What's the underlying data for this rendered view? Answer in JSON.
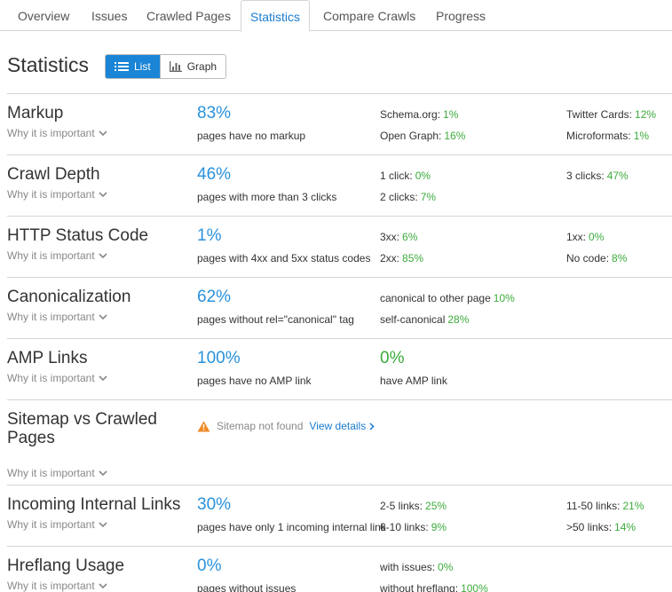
{
  "tabs": [
    {
      "label": "Overview",
      "active": false
    },
    {
      "label": "Issues",
      "active": false
    },
    {
      "label": "Crawled Pages",
      "active": false
    },
    {
      "label": "Statistics",
      "active": true
    },
    {
      "label": "Compare Crawls",
      "active": false
    },
    {
      "label": "Progress",
      "active": false
    }
  ],
  "page": {
    "title": "Statistics",
    "view_toggle": {
      "list_label": "List",
      "graph_label": "Graph",
      "selected": "List"
    }
  },
  "why_label": "Why it is important",
  "rows": {
    "markup": {
      "title": "Markup",
      "main_value": "83%",
      "main_desc": "pages have no markup",
      "stats": [
        {
          "label": "Schema.org:",
          "value": "1%"
        },
        {
          "label": "Open Graph:",
          "value": "16%"
        },
        {
          "label": "Twitter Cards:",
          "value": "12%"
        },
        {
          "label": "Microformats:",
          "value": "1%"
        }
      ]
    },
    "crawl_depth": {
      "title": "Crawl Depth",
      "main_value": "46%",
      "main_desc": "pages with more than 3 clicks",
      "stats": [
        {
          "label": "1 click:",
          "value": "0%"
        },
        {
          "label": "2 clicks:",
          "value": "7%"
        },
        {
          "label": "3 clicks:",
          "value": "47%"
        }
      ]
    },
    "http_status": {
      "title": "HTTP Status Code",
      "main_value": "1%",
      "main_desc": "pages with 4xx and 5xx status codes",
      "stats": [
        {
          "label": "3xx:",
          "value": "6%"
        },
        {
          "label": "2xx:",
          "value": "85%"
        },
        {
          "label": "1xx:",
          "value": "0%"
        },
        {
          "label": "No code:",
          "value": "8%"
        }
      ]
    },
    "canonicalization": {
      "title": "Canonicalization",
      "main_value": "62%",
      "main_desc": "pages without rel=\"canonical\" tag",
      "stats": [
        {
          "label": "canonical to other page",
          "value": "10%"
        },
        {
          "label": "self-canonical",
          "value": "28%"
        }
      ]
    },
    "amp_links": {
      "title": "AMP Links",
      "main_value": "100%",
      "main_desc": "pages have no AMP link",
      "secondary_value": "0%",
      "secondary_desc": "have AMP link"
    },
    "sitemap": {
      "title": "Sitemap vs Crawled Pages",
      "message": "Sitemap not found",
      "link": "View details"
    },
    "internal_links": {
      "title": "Incoming Internal Links",
      "main_value": "30%",
      "main_desc": "pages have only 1 incoming internal link",
      "stats": [
        {
          "label": "2-5 links:",
          "value": "25%"
        },
        {
          "label": "6-10 links:",
          "value": "9%"
        },
        {
          "label": "11-50 links:",
          "value": "21%"
        },
        {
          "label": ">50 links:",
          "value": "14%"
        }
      ]
    },
    "hreflang": {
      "title": "Hreflang Usage",
      "main_value": "0%",
      "main_desc": "pages without issues",
      "stats": [
        {
          "label": "with issues:",
          "value": "0%"
        },
        {
          "label": "without hreflang:",
          "value": "100%"
        }
      ]
    }
  }
}
